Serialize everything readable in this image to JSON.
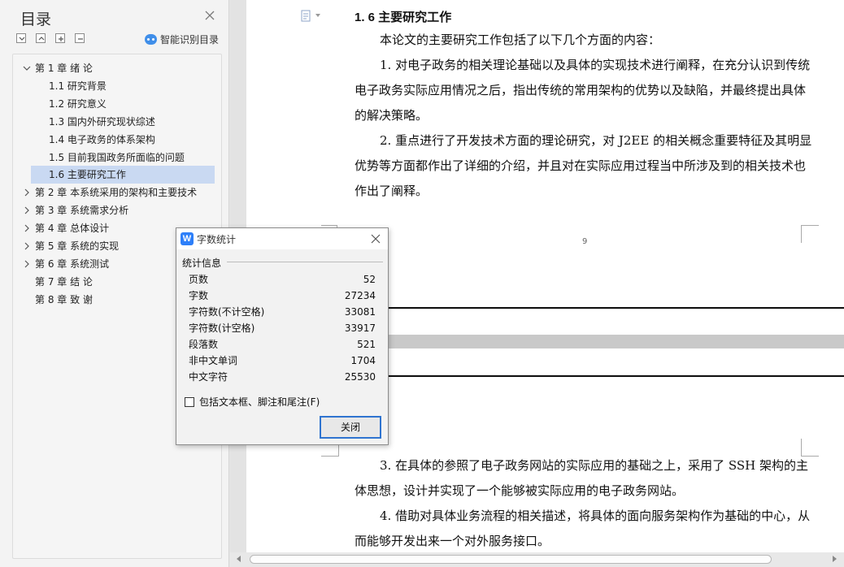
{
  "toc": {
    "title": "目录",
    "smart_label": "智能识别目录",
    "items": [
      {
        "label": "第 1 章  绪  论",
        "level": 1,
        "expanded": true
      },
      {
        "label": "1.1  研究背景",
        "level": 2
      },
      {
        "label": "1.2  研究意义",
        "level": 2
      },
      {
        "label": "1.3  国内外研究现状综述",
        "level": 2
      },
      {
        "label": "1.4  电子政务的体系架构",
        "level": 2
      },
      {
        "label": "1.5  目前我国政务所面临的问题",
        "level": 2
      },
      {
        "label": "1.6  主要研究工作",
        "level": 2,
        "selected": true
      },
      {
        "label": "第 2 章  本系统采用的架构和主要技术",
        "level": 1,
        "expanded": false
      },
      {
        "label": "第 3 章  系统需求分析",
        "level": 1,
        "expanded": false
      },
      {
        "label": "第 4 章  总体设计",
        "level": 1,
        "expanded": false
      },
      {
        "label": "第 5 章   系统的实现",
        "level": 1,
        "expanded": false
      },
      {
        "label": "第 6 章  系统测试",
        "level": 1,
        "expanded": false
      },
      {
        "label": "第 7 章  结    论",
        "level": 1
      },
      {
        "label": "第 8 章  致      谢",
        "level": 1
      }
    ]
  },
  "document": {
    "heading": "1. 6  主要研究工作",
    "para_intro": "本论文的主要研究工作包括了以下几个方面的内容：",
    "para_1": "1. 对电子政务的相关理论基础以及具体的实现技术进行阐释，在充分认识到传统电子政务实际应用情况之后，指出传统的常用架构的优势以及缺陷，并最终提出具体的解决策略。",
    "para_2": "2. 重点进行了开发技术方面的理论研究，对 J2EE 的相关概念重要特征及其明显优势等方面都作出了详细的介绍，并且对在实际应用过程当中所涉及到的相关技术也作出了阐释。",
    "page_number": "9",
    "para_3": "3. 在具体的参照了电子政务网站的实际应用的基础之上，采用了 SSH 架构的主体思想，设计并实现了一个能够被实际应用的电子政务网站。",
    "para_4": "4. 借助对具体业务流程的相关描述，将具体的面向服务架构作为基础的中心，从而能够开发出来一个对外服务接口。"
  },
  "dialog": {
    "title": "字数统计",
    "section": "统计信息",
    "stats": [
      {
        "label": "页数",
        "value": "52"
      },
      {
        "label": "字数",
        "value": "27234"
      },
      {
        "label": "字符数(不计空格)",
        "value": "33081"
      },
      {
        "label": "字符数(计空格)",
        "value": "33917"
      },
      {
        "label": "段落数",
        "value": "521"
      },
      {
        "label": "非中文单词",
        "value": "1704"
      },
      {
        "label": "中文字符",
        "value": "25530"
      }
    ],
    "checkbox_label": "包括文本框、脚注和尾注(F)",
    "checkbox_checked": false,
    "close_button": "关闭"
  },
  "colors": {
    "selection": "#c9d9f2",
    "accent": "#2f74d0",
    "app_icon": "#2d7ff9"
  }
}
